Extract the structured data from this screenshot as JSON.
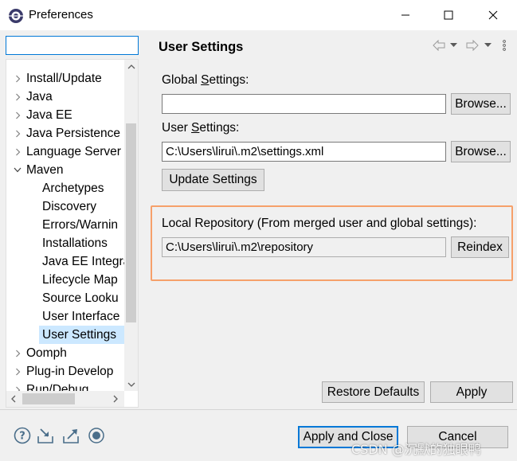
{
  "window": {
    "title": "Preferences"
  },
  "filter": {
    "value": "",
    "placeholder": ""
  },
  "tree": {
    "items": [
      {
        "label": "Install/Update",
        "indent": 0,
        "twisty": "collapsed"
      },
      {
        "label": "Java",
        "indent": 0,
        "twisty": "collapsed"
      },
      {
        "label": "Java EE",
        "indent": 0,
        "twisty": "collapsed"
      },
      {
        "label": "Java Persistence",
        "indent": 0,
        "twisty": "collapsed"
      },
      {
        "label": "Language Server",
        "indent": 0,
        "twisty": "collapsed"
      },
      {
        "label": "Maven",
        "indent": 0,
        "twisty": "expanded"
      },
      {
        "label": "Archetypes",
        "indent": 1,
        "twisty": "none"
      },
      {
        "label": "Discovery",
        "indent": 1,
        "twisty": "none"
      },
      {
        "label": "Errors/Warnin",
        "indent": 1,
        "twisty": "none"
      },
      {
        "label": "Installations",
        "indent": 1,
        "twisty": "none"
      },
      {
        "label": "Java EE Integra",
        "indent": 1,
        "twisty": "none"
      },
      {
        "label": "Lifecycle Map",
        "indent": 1,
        "twisty": "none"
      },
      {
        "label": "Source Looku",
        "indent": 1,
        "twisty": "none"
      },
      {
        "label": "User Interface",
        "indent": 1,
        "twisty": "none"
      },
      {
        "label": "User Settings",
        "indent": 1,
        "twisty": "none",
        "selected": true
      },
      {
        "label": "Oomph",
        "indent": 0,
        "twisty": "collapsed"
      },
      {
        "label": "Plug-in Develop",
        "indent": 0,
        "twisty": "collapsed"
      },
      {
        "label": "Run/Debug",
        "indent": 0,
        "twisty": "collapsed"
      }
    ]
  },
  "page": {
    "title": "User Settings",
    "global_settings": {
      "label_pre": "Global ",
      "label_mnemonic": "S",
      "label_post": "ettings:",
      "value": "",
      "browse_label": "Browse..."
    },
    "user_settings": {
      "label_pre": "User ",
      "label_mnemonic": "S",
      "label_post": "ettings:",
      "value": "C:\\Users\\lirui\\.m2\\settings.xml",
      "browse_label": "Browse...",
      "update_label": "Update Settings"
    },
    "local_repo": {
      "label": "Local Repository (From merged user and global settings):",
      "value": "C:\\Users\\lirui\\.m2\\repository",
      "reindex_label": "Reindex"
    },
    "restore_defaults_label": "Restore Defaults",
    "apply_label": "Apply"
  },
  "footer": {
    "apply_close_label": "Apply and Close",
    "cancel_label": "Cancel",
    "watermark": "CSDN @沉默的独眼鸭"
  },
  "colors": {
    "selection": "#cce8ff",
    "highlight_border": "#f6a06a",
    "focus_blue": "#0078d7"
  }
}
